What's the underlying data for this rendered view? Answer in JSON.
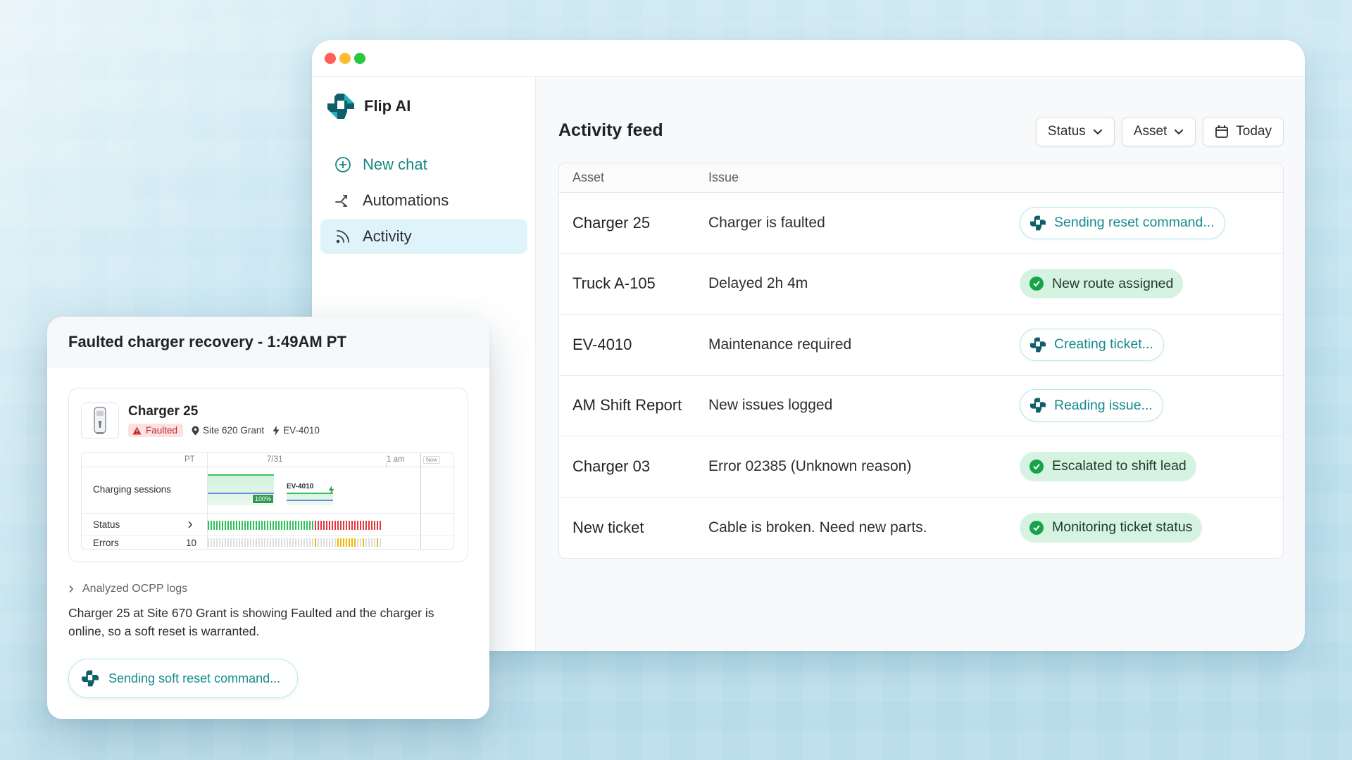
{
  "app": {
    "name": "Flip AI"
  },
  "sidebar": {
    "items": [
      {
        "label": "New chat",
        "icon": "plus-circle-icon"
      },
      {
        "label": "Automations",
        "icon": "branch-icon"
      },
      {
        "label": "Activity",
        "icon": "rss-icon",
        "active": true
      }
    ]
  },
  "feed": {
    "title": "Activity feed",
    "filters": {
      "status": "Status",
      "asset": "Asset",
      "date": "Today"
    },
    "columns": {
      "asset": "Asset",
      "issue": "Issue"
    },
    "rows": [
      {
        "asset": "Charger 25",
        "issue": "Charger is faulted",
        "action": "Sending reset command...",
        "state": "working"
      },
      {
        "asset": "Truck A-105",
        "issue": "Delayed 2h 4m",
        "action": "New route assigned",
        "state": "done"
      },
      {
        "asset": "EV-4010",
        "issue": "Maintenance required",
        "action": "Creating ticket...",
        "state": "working"
      },
      {
        "asset": "AM Shift Report",
        "issue": "New issues logged",
        "action": "Reading issue...",
        "state": "working"
      },
      {
        "asset": "Charger 03",
        "issue": "Error 02385 (Unknown reason)",
        "action": "Escalated to shift lead",
        "state": "done"
      },
      {
        "asset": "New ticket",
        "issue": "Cable is broken. Need new parts.",
        "action": "Monitoring ticket status",
        "state": "done"
      }
    ]
  },
  "card": {
    "title": "Faulted charger recovery - 1:49AM PT",
    "charger": {
      "name": "Charger 25",
      "status": "Faulted",
      "site": "Site 620 Grant",
      "vehicle": "EV-4010"
    },
    "timeline": {
      "tz": "PT",
      "date": "7/31",
      "time": "1 am",
      "now": "Now",
      "rows": {
        "sessions": "Charging sessions",
        "status": "Status",
        "errors": "Errors"
      },
      "errors_count": "10",
      "session_pct": "100%",
      "session_vehicle": "EV-4010"
    },
    "analyzed": "Analyzed OCPP logs",
    "summary": "Charger 25 at Site 670 Grant is showing Faulted and the charger is online, so a soft reset is warranted.",
    "action": "Sending soft reset command..."
  },
  "colors": {
    "accent": "#148b8e",
    "brand": "#0f5f6b",
    "success": "#17a34a",
    "fault": "#c22b2b",
    "status_ok": "#2ec25a",
    "status_bad": "#e2383f",
    "error_tick": "#f2b705"
  }
}
